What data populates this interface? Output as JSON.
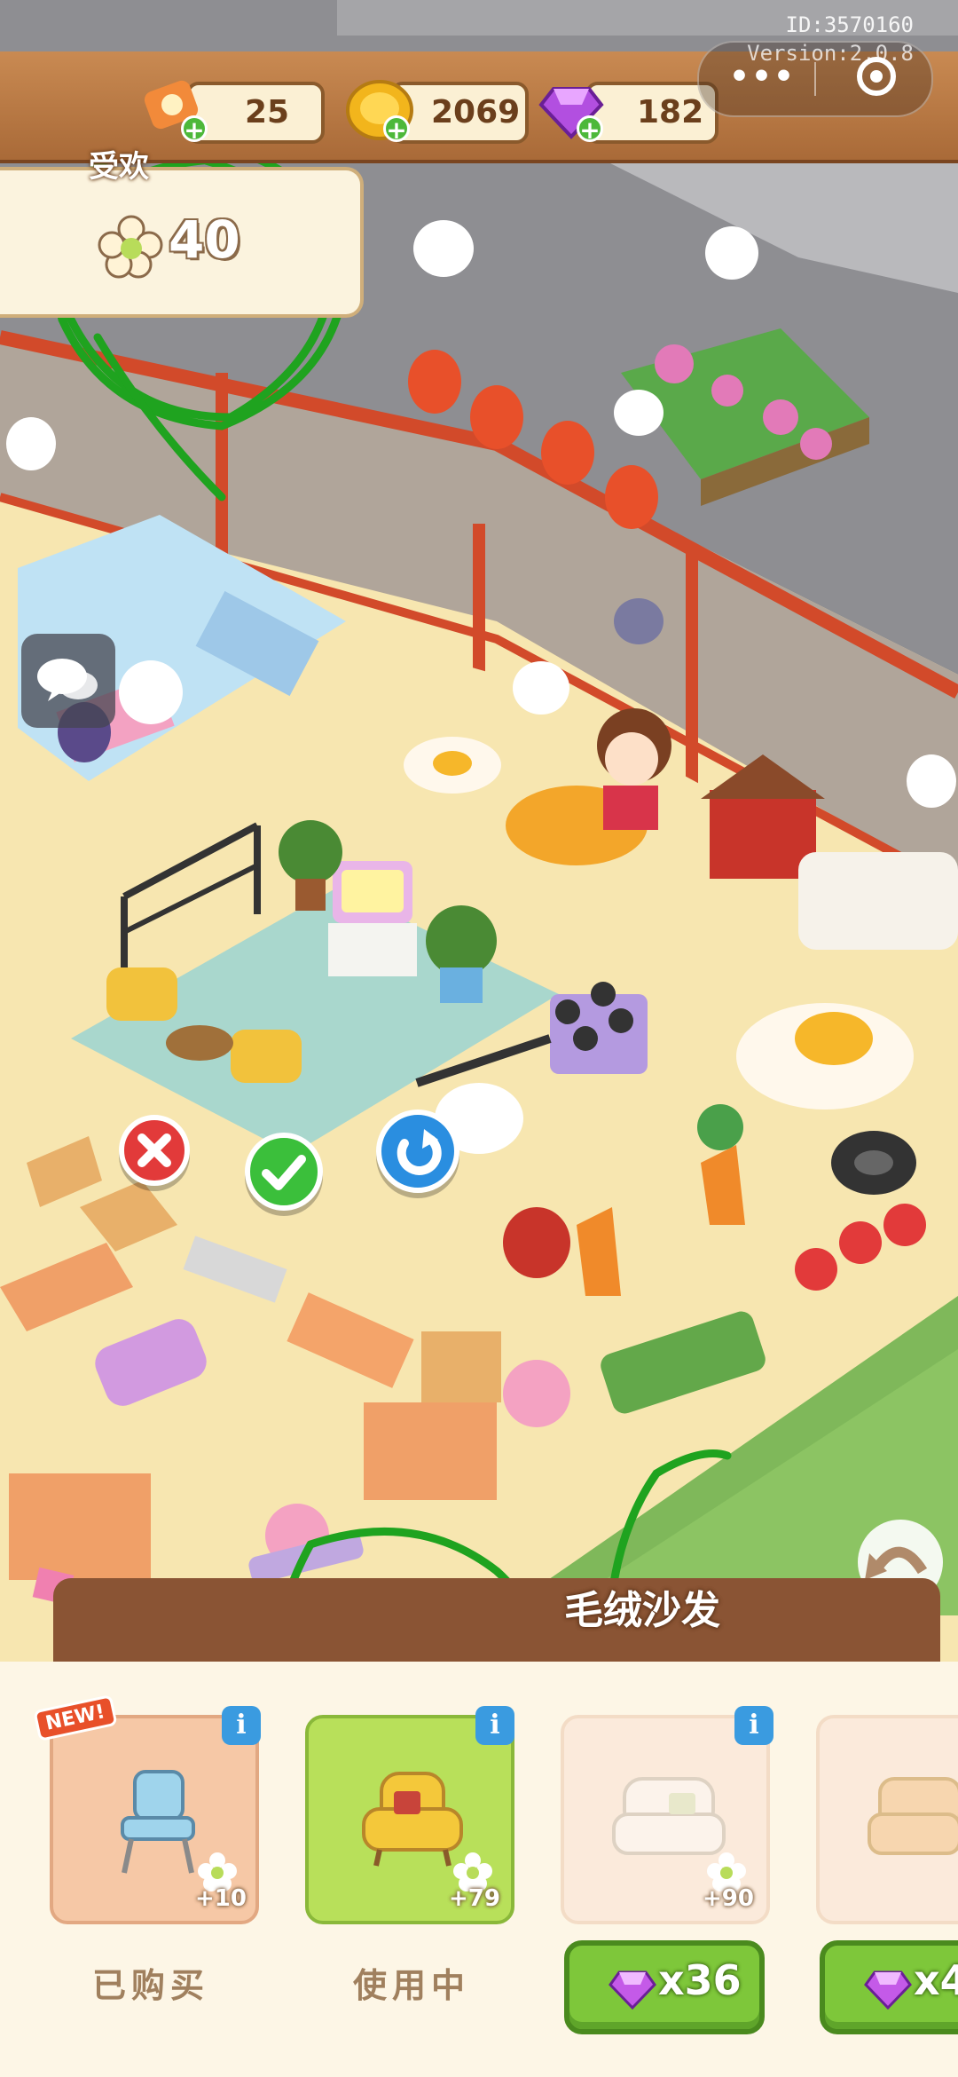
{
  "header": {
    "id_text": "ID:3570160",
    "version_text": "Version:2.0.8"
  },
  "resources": {
    "tickets": "25",
    "coins": "2069",
    "gems": "182"
  },
  "popularity": {
    "title": "受欢",
    "value": "40"
  },
  "item_banner": {
    "title": "毛绒沙发"
  },
  "cards": [
    {
      "bonus": "+10",
      "status": "已购买",
      "badge": "NEW!",
      "icon": "blue-chair-icon"
    },
    {
      "bonus": "+79",
      "status": "使用中",
      "icon": "yellow-armchair-icon"
    },
    {
      "bonus": "+90",
      "price": "x36",
      "icon": "white-sofa-icon"
    },
    {
      "bonus": "",
      "price": "x4",
      "icon": "sofa-icon"
    }
  ],
  "colors": {
    "hud": "#a96a38",
    "floor": "#f7e6b0",
    "selected_card": "#b8e05a",
    "annotation": "#1fa31f",
    "confirm": "#3bbf3b",
    "cancel": "#e23a3a",
    "rotate": "#2a8ee0"
  }
}
